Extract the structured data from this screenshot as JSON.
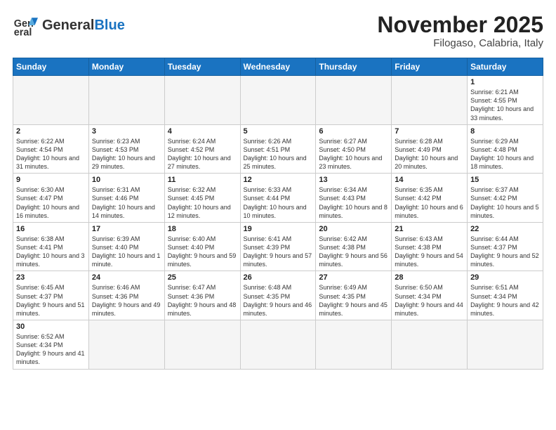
{
  "logo": {
    "general": "General",
    "blue": "Blue"
  },
  "title": "November 2025",
  "subtitle": "Filogaso, Calabria, Italy",
  "days_of_week": [
    "Sunday",
    "Monday",
    "Tuesday",
    "Wednesday",
    "Thursday",
    "Friday",
    "Saturday"
  ],
  "weeks": [
    [
      {
        "day": "",
        "empty": true
      },
      {
        "day": "",
        "empty": true
      },
      {
        "day": "",
        "empty": true
      },
      {
        "day": "",
        "empty": true
      },
      {
        "day": "",
        "empty": true
      },
      {
        "day": "",
        "empty": true
      },
      {
        "day": "1",
        "sunrise": "6:21 AM",
        "sunset": "4:55 PM",
        "daylight": "10 hours and 33 minutes."
      }
    ],
    [
      {
        "day": "2",
        "sunrise": "6:22 AM",
        "sunset": "4:54 PM",
        "daylight": "10 hours and 31 minutes."
      },
      {
        "day": "3",
        "sunrise": "6:23 AM",
        "sunset": "4:53 PM",
        "daylight": "10 hours and 29 minutes."
      },
      {
        "day": "4",
        "sunrise": "6:24 AM",
        "sunset": "4:52 PM",
        "daylight": "10 hours and 27 minutes."
      },
      {
        "day": "5",
        "sunrise": "6:26 AM",
        "sunset": "4:51 PM",
        "daylight": "10 hours and 25 minutes."
      },
      {
        "day": "6",
        "sunrise": "6:27 AM",
        "sunset": "4:50 PM",
        "daylight": "10 hours and 23 minutes."
      },
      {
        "day": "7",
        "sunrise": "6:28 AM",
        "sunset": "4:49 PM",
        "daylight": "10 hours and 20 minutes."
      },
      {
        "day": "8",
        "sunrise": "6:29 AM",
        "sunset": "4:48 PM",
        "daylight": "10 hours and 18 minutes."
      }
    ],
    [
      {
        "day": "9",
        "sunrise": "6:30 AM",
        "sunset": "4:47 PM",
        "daylight": "10 hours and 16 minutes."
      },
      {
        "day": "10",
        "sunrise": "6:31 AM",
        "sunset": "4:46 PM",
        "daylight": "10 hours and 14 minutes."
      },
      {
        "day": "11",
        "sunrise": "6:32 AM",
        "sunset": "4:45 PM",
        "daylight": "10 hours and 12 minutes."
      },
      {
        "day": "12",
        "sunrise": "6:33 AM",
        "sunset": "4:44 PM",
        "daylight": "10 hours and 10 minutes."
      },
      {
        "day": "13",
        "sunrise": "6:34 AM",
        "sunset": "4:43 PM",
        "daylight": "10 hours and 8 minutes."
      },
      {
        "day": "14",
        "sunrise": "6:35 AM",
        "sunset": "4:42 PM",
        "daylight": "10 hours and 6 minutes."
      },
      {
        "day": "15",
        "sunrise": "6:37 AM",
        "sunset": "4:42 PM",
        "daylight": "10 hours and 5 minutes."
      }
    ],
    [
      {
        "day": "16",
        "sunrise": "6:38 AM",
        "sunset": "4:41 PM",
        "daylight": "10 hours and 3 minutes."
      },
      {
        "day": "17",
        "sunrise": "6:39 AM",
        "sunset": "4:40 PM",
        "daylight": "10 hours and 1 minute."
      },
      {
        "day": "18",
        "sunrise": "6:40 AM",
        "sunset": "4:40 PM",
        "daylight": "9 hours and 59 minutes."
      },
      {
        "day": "19",
        "sunrise": "6:41 AM",
        "sunset": "4:39 PM",
        "daylight": "9 hours and 57 minutes."
      },
      {
        "day": "20",
        "sunrise": "6:42 AM",
        "sunset": "4:38 PM",
        "daylight": "9 hours and 56 minutes."
      },
      {
        "day": "21",
        "sunrise": "6:43 AM",
        "sunset": "4:38 PM",
        "daylight": "9 hours and 54 minutes."
      },
      {
        "day": "22",
        "sunrise": "6:44 AM",
        "sunset": "4:37 PM",
        "daylight": "9 hours and 52 minutes."
      }
    ],
    [
      {
        "day": "23",
        "sunrise": "6:45 AM",
        "sunset": "4:37 PM",
        "daylight": "9 hours and 51 minutes."
      },
      {
        "day": "24",
        "sunrise": "6:46 AM",
        "sunset": "4:36 PM",
        "daylight": "9 hours and 49 minutes."
      },
      {
        "day": "25",
        "sunrise": "6:47 AM",
        "sunset": "4:36 PM",
        "daylight": "9 hours and 48 minutes."
      },
      {
        "day": "26",
        "sunrise": "6:48 AM",
        "sunset": "4:35 PM",
        "daylight": "9 hours and 46 minutes."
      },
      {
        "day": "27",
        "sunrise": "6:49 AM",
        "sunset": "4:35 PM",
        "daylight": "9 hours and 45 minutes."
      },
      {
        "day": "28",
        "sunrise": "6:50 AM",
        "sunset": "4:34 PM",
        "daylight": "9 hours and 44 minutes."
      },
      {
        "day": "29",
        "sunrise": "6:51 AM",
        "sunset": "4:34 PM",
        "daylight": "9 hours and 42 minutes."
      }
    ],
    [
      {
        "day": "30",
        "sunrise": "6:52 AM",
        "sunset": "4:34 PM",
        "daylight": "9 hours and 41 minutes."
      },
      {
        "day": "",
        "empty": true
      },
      {
        "day": "",
        "empty": true
      },
      {
        "day": "",
        "empty": true
      },
      {
        "day": "",
        "empty": true
      },
      {
        "day": "",
        "empty": true
      },
      {
        "day": "",
        "empty": true
      }
    ]
  ]
}
